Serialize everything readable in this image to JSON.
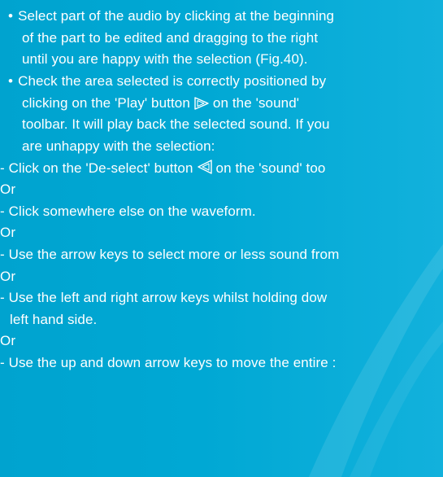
{
  "colors": {
    "background": "#00a8d4",
    "text": "#ffffff"
  },
  "page": {
    "bullets": [
      {
        "bullet": "•",
        "lines": [
          "Select part of the audio by clicking at the beginning",
          "of the part to be edited and dragging to the right",
          "until you are happy with the selection (Fig.40)."
        ]
      },
      {
        "bullet": "•",
        "line1": "Check the area selected is correctly positioned by",
        "line2_before": "clicking on the 'Play' button",
        "line2_after": "on the 'sound'",
        "line3": "toolbar. It will play back the selected sound. If you",
        "line4": "are unhappy with the selection:"
      }
    ],
    "deselect_before": "- Click on the 'De-select' button",
    "deselect_after": "on the 'sound' too",
    "or1": "Or",
    "waveform": "- Click somewhere else on the waveform.",
    "or2": "Or",
    "arrow_keys": "- Use the arrow keys to select more or less sound from",
    "or3": "Or",
    "left_right_1": "- Use the left and right arrow keys whilst holding dow",
    "left_right_2": "left hand side.",
    "or4": "Or",
    "up_down": "- Use the up and down arrow keys to move the entire :"
  },
  "icons": {
    "play": "play-icon",
    "deselect": "deselect-icon"
  }
}
